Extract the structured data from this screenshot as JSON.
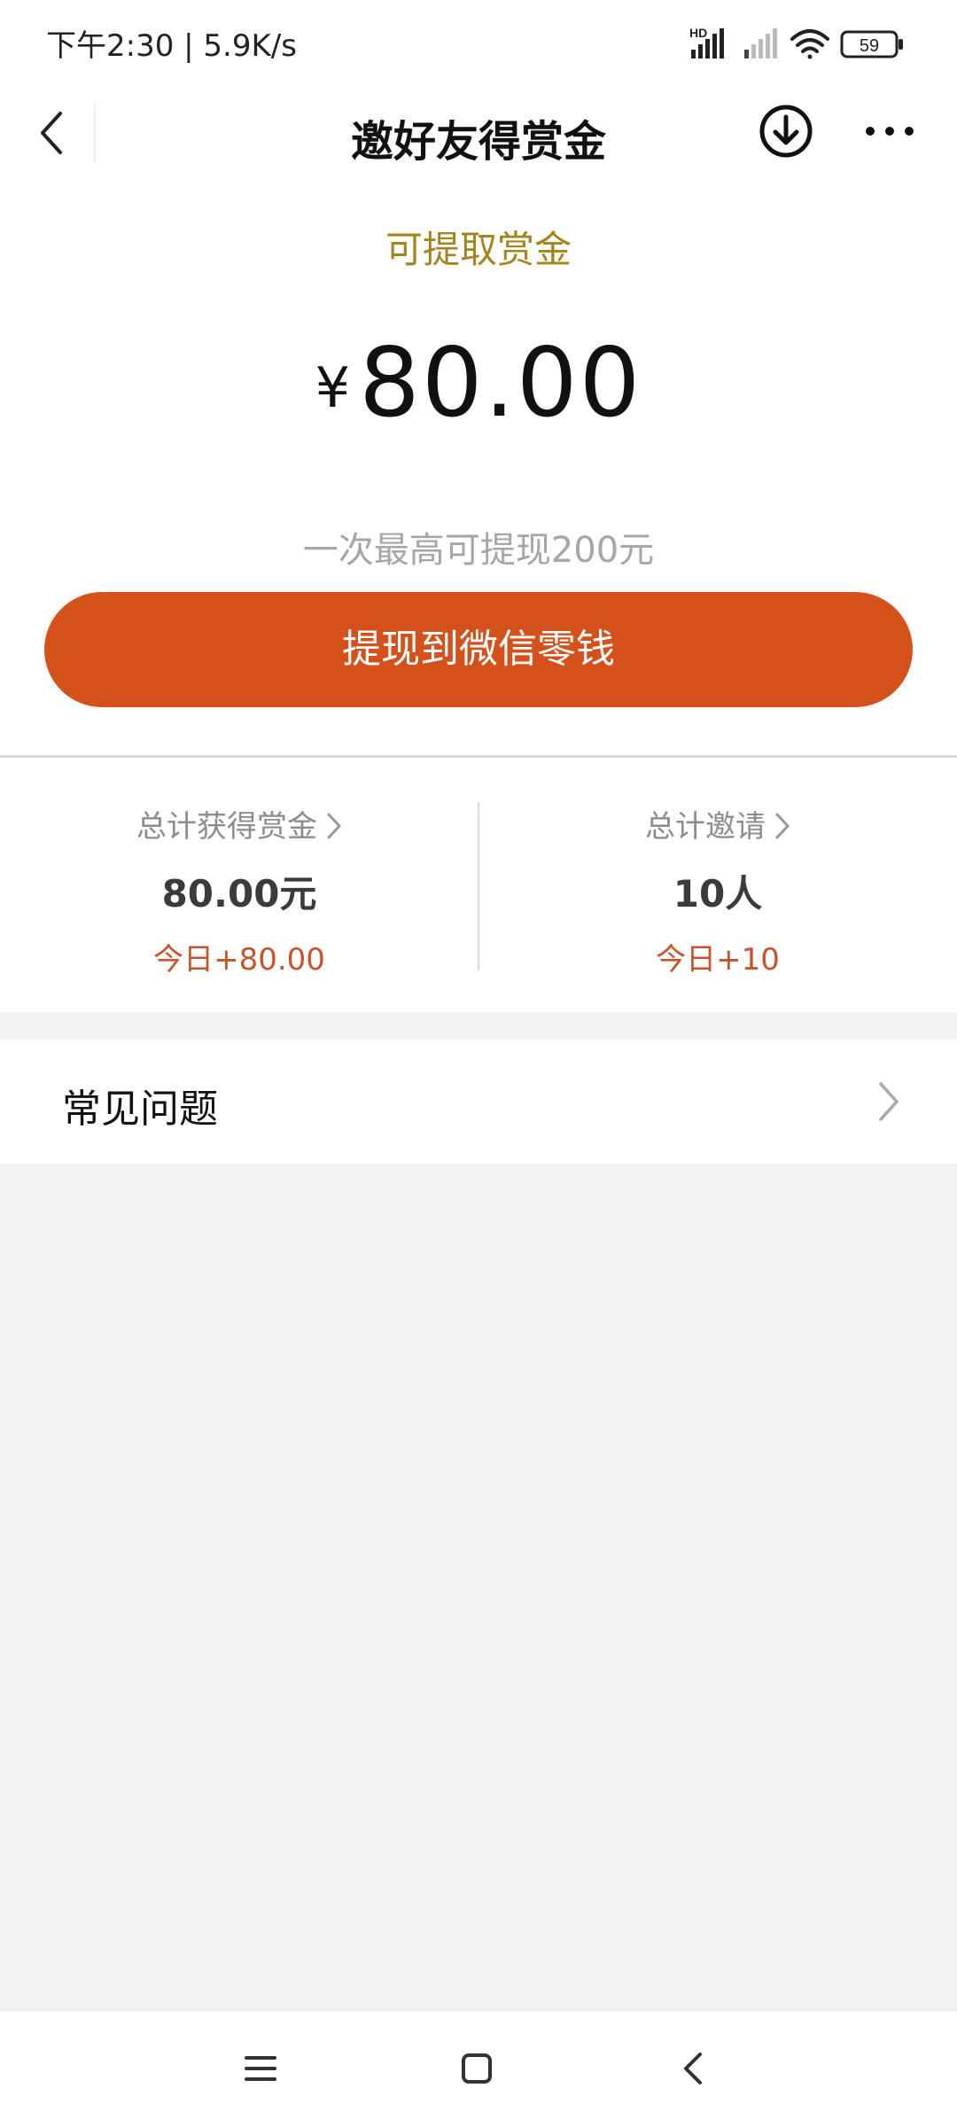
{
  "status_bar": {
    "time_speed": "下午2:30 | 5.9K/s",
    "network_badge": "HD",
    "battery": "59"
  },
  "nav": {
    "title": "邀好友得赏金"
  },
  "reward": {
    "label": "可提取赏金",
    "currency": "¥",
    "amount": "80.00",
    "limit_note": "一次最高可提现200元",
    "withdraw_button": "提现到微信零钱"
  },
  "stats": {
    "total_reward": {
      "label": "总计获得赏金",
      "value": "80.00元",
      "today": "今日+80.00"
    },
    "total_invites": {
      "label": "总计邀请",
      "value": "10人",
      "today": "今日+10"
    }
  },
  "faq": {
    "label": "常见问题"
  },
  "colors": {
    "accent": "#d5511b",
    "gold_label": "#a4841f",
    "today_text": "#c8522a"
  },
  "icons": {
    "back": "chevron-left-icon",
    "download": "download-circle-icon",
    "more": "more-dots-icon",
    "chevron": "chevron-right-icon"
  }
}
